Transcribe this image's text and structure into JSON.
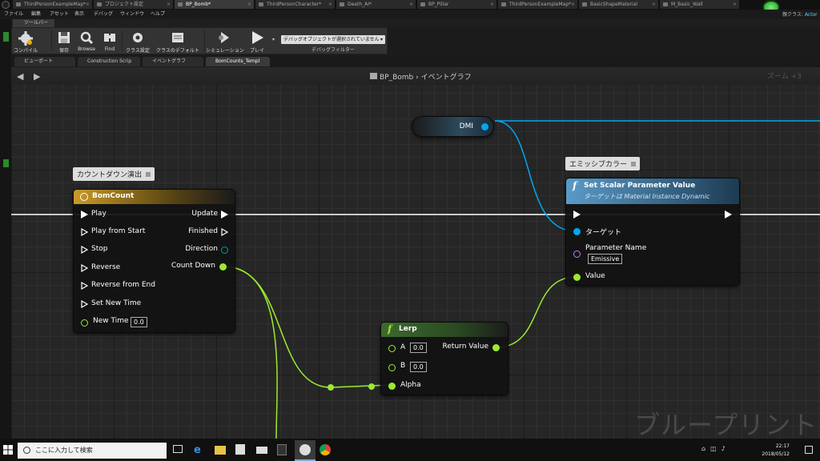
{
  "window": {
    "doc_tabs": [
      "ThirdPersonExampleMap*",
      "プロジェクト設定",
      "BP_Bomb*",
      "ThirdPersonCharacter*",
      "Death_AI*",
      "BP_Pillar",
      "ThirdPersonExampleMap*",
      "BasicShapeMaterial",
      "M_Basic_Wall"
    ],
    "menu": [
      "ファイル",
      "編集",
      "アセット",
      "表示",
      "デバッグ",
      "ウィンドウ",
      "ヘルプ"
    ],
    "parent_class_label": "親クラス:",
    "parent_class_value": "Actor"
  },
  "toolbar": {
    "tab_label": "ツールバー",
    "buttons": [
      "コンパイル",
      "保存",
      "Browse",
      "Find",
      "クラス設定",
      "クラスのデフォルト",
      "シミュレーション",
      "プレイ"
    ],
    "debug_object": "デバッグオブジェクトが選択されていません",
    "debug_filter_label": "デバッグフィルター"
  },
  "editor_tabs": [
    "ビューポート",
    "Construction Scrip",
    "イベントグラフ",
    "BomCounts_Templ"
  ],
  "graph": {
    "breadcrumb_root": "BP_Bomb",
    "breadcrumb_sep": "›",
    "breadcrumb_leaf": "イベントグラフ",
    "zoom": "ズーム +3",
    "watermark": "ブループリント"
  },
  "nodes": {
    "timeline": {
      "comment": "カウントダウン演出",
      "title": "BomCount",
      "inputs": [
        "Play",
        "Play from Start",
        "Stop",
        "Reverse",
        "Reverse from End",
        "Set New Time",
        "New Time"
      ],
      "new_time_value": "0.0",
      "outputs": [
        "Update",
        "Finished",
        "Direction",
        "Count Down"
      ]
    },
    "dmi": {
      "label": "DMI"
    },
    "set_scalar": {
      "comment": "エミッシブカラー",
      "title": "Set Scalar Parameter Value",
      "subtitle": "ターゲットは Material Instance Dynamic",
      "target_label": "ターゲット",
      "param_name_label": "Parameter Name",
      "param_name_value": "Emissive",
      "value_label": "Value"
    },
    "lerp": {
      "title": "Lerp",
      "a_label": "A",
      "a_value": "0.0",
      "b_label": "B",
      "b_value": "0.0",
      "alpha_label": "Alpha",
      "return_label": "Return Value"
    }
  },
  "colors": {
    "exec": "#ffffff",
    "float_pin": "#9cea2f",
    "object_pin": "#00a8f3",
    "name_pin": "#c77bff",
    "struct_pin": "#00a3a3",
    "timeline_header": "#a8821e",
    "function_header": "#4c8bb5"
  },
  "taskbar": {
    "search_placeholder": "ここに入力して検索",
    "time": "22:17",
    "date": "2018/05/12"
  }
}
